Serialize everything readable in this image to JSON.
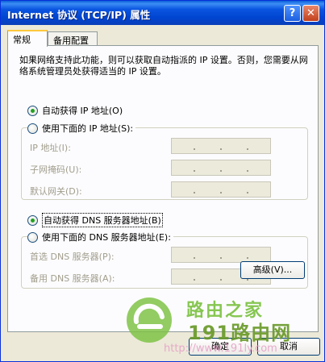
{
  "window": {
    "title": "Internet 协议 (TCP/IP) 属性",
    "help_label": "?",
    "close_label": "✕"
  },
  "tabs": [
    {
      "label": "常规",
      "active": true
    },
    {
      "label": "备用配置",
      "active": false
    }
  ],
  "description": "如果网络支持此功能，则可以获取自动指派的 IP 设置。否则，您需要从网络系统管理员处获得适当的 IP 设置。",
  "ip": {
    "auto_label": "自动获得 IP 地址(O)",
    "auto_checked": true,
    "manual_label": "使用下面的 IP 地址(S):",
    "manual_checked": false,
    "fields": [
      {
        "label": "IP 地址(I):",
        "value": "  .  .  ."
      },
      {
        "label": "子网掩码(U):",
        "value": "  .  .  ."
      },
      {
        "label": "默认网关(D):",
        "value": "  .  .  ."
      }
    ]
  },
  "dns": {
    "auto_label": "自动获得 DNS 服务器地址(B)",
    "auto_checked": true,
    "manual_label": "使用下面的 DNS 服务器地址(E):",
    "manual_checked": false,
    "fields": [
      {
        "label": "首选 DNS 服务器(P):",
        "value": "  .  .  ."
      },
      {
        "label": "备用 DNS 服务器(A):",
        "value": "  .  .  ."
      }
    ]
  },
  "buttons": {
    "advanced": "高级(V)...",
    "ok": "确定",
    "cancel": "取消"
  },
  "watermark": {
    "line1": "路由之家",
    "line2": "191路由网",
    "url": "http://www.191ly.com"
  },
  "colors": {
    "titlebar": "#0a55e0",
    "radio_dot": "#21a121",
    "tab_highlight": "#ffc83c",
    "watermark_green": "#7cc243"
  }
}
